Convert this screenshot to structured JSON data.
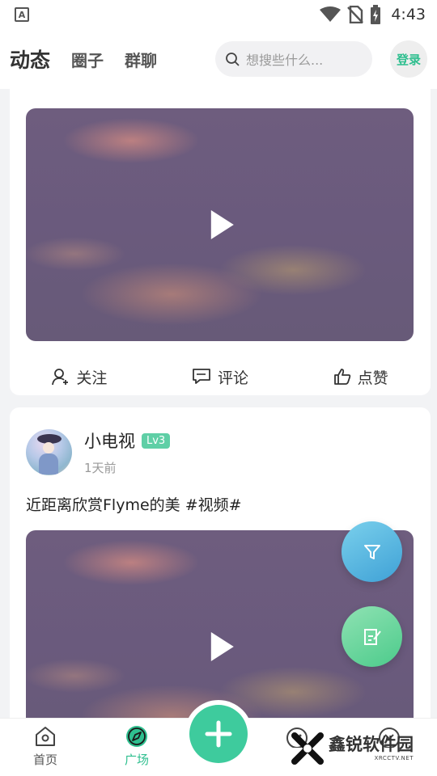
{
  "status_bar": {
    "time": "4:43",
    "app_icon_letter": "A"
  },
  "top_nav": {
    "tabs": [
      {
        "label": "动态",
        "active": true
      },
      {
        "label": "圈子",
        "active": false
      },
      {
        "label": "群聊",
        "active": false
      }
    ],
    "search_placeholder": "想搜些什么...",
    "login_label": "登录"
  },
  "card1": {
    "actions": {
      "follow": "关注",
      "comment": "评论",
      "like": "点赞"
    }
  },
  "card2": {
    "author_name": "小电视",
    "level": "Lv3",
    "time": "1天前",
    "text": "近距离欣赏Flyme的美 #视频#"
  },
  "bottom_nav": {
    "items": [
      {
        "label": "首页",
        "active": false
      },
      {
        "label": "广场",
        "active": true
      }
    ]
  },
  "watermark": {
    "text": "鑫锐软件园",
    "sub": "XRCCTV.NET"
  },
  "colors": {
    "accent": "#3ecb9d",
    "filter_fab": "#4aaedd",
    "edit_fab": "#5ccf94"
  },
  "icons": [
    "signal-icon",
    "wifi-icon",
    "no-sim-icon",
    "battery-icon",
    "search-icon",
    "play-icon",
    "follow-icon",
    "comment-icon",
    "like-icon",
    "filter-icon",
    "edit-icon",
    "home-icon",
    "compass-icon",
    "add-icon"
  ]
}
